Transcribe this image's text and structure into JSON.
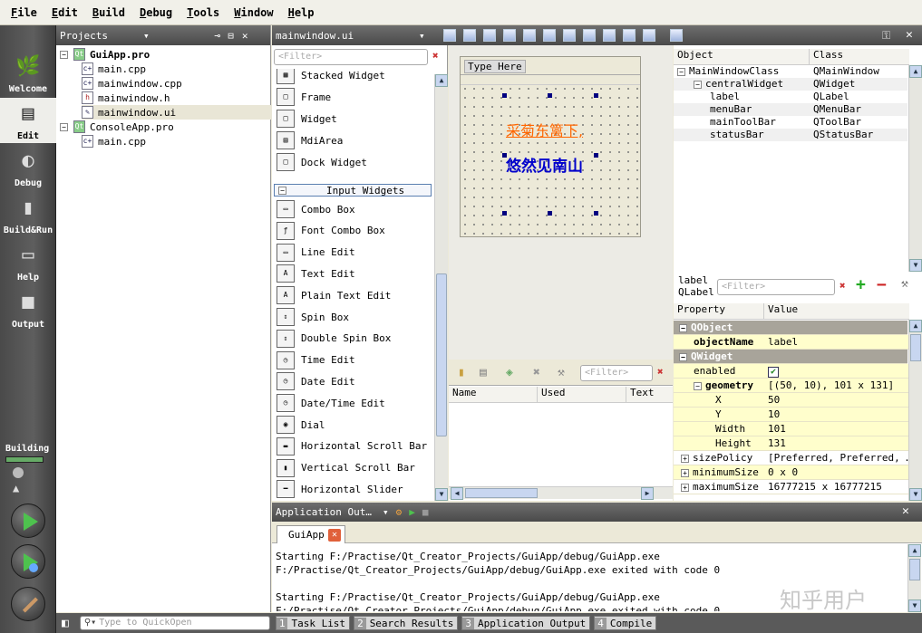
{
  "menubar": [
    "File",
    "Edit",
    "Build",
    "Debug",
    "Tools",
    "Window",
    "Help"
  ],
  "modes": [
    {
      "label": "Welcome",
      "icon": "welcome-icon"
    },
    {
      "label": "Edit",
      "icon": "edit-icon"
    },
    {
      "label": "Debug",
      "icon": "debug-icon"
    },
    {
      "label": "Build&Run",
      "icon": "build-run-icon"
    },
    {
      "label": "Help",
      "icon": "help-icon"
    },
    {
      "label": "Output",
      "icon": "output-icon"
    }
  ],
  "build": {
    "label": "Building"
  },
  "projects": {
    "title": "Projects",
    "tree": [
      {
        "label": "GuiApp.pro",
        "kind": "pro",
        "bold": true
      },
      {
        "label": "main.cpp",
        "kind": "cpp"
      },
      {
        "label": "mainwindow.cpp",
        "kind": "cpp"
      },
      {
        "label": "mainwindow.h",
        "kind": "h"
      },
      {
        "label": "mainwindow.ui",
        "kind": "ui",
        "selected": true
      },
      {
        "label": "ConsoleApp.pro",
        "kind": "pro"
      },
      {
        "label": "main.cpp",
        "kind": "cpp"
      }
    ]
  },
  "editor": {
    "file": "mainwindow.ui"
  },
  "widgetbox": {
    "filter_placeholder": "<Filter>",
    "items": [
      "Stacked Widget",
      "Frame",
      "Widget",
      "MdiArea",
      "Dock Widget"
    ],
    "group": "Input Widgets",
    "input_items": [
      "Combo Box",
      "Font Combo Box",
      "Line Edit",
      "Text Edit",
      "Plain Text Edit",
      "Spin Box",
      "Double Spin Box",
      "Time Edit",
      "Date Edit",
      "Date/Time Edit",
      "Dial",
      "Horizontal Scroll Bar",
      "Vertical Scroll Bar",
      "Horizontal Slider"
    ]
  },
  "form": {
    "menu_placeholder": "Type Here",
    "line1": "采菊东篱下,",
    "line2": "悠然见南山"
  },
  "signals": {
    "filter_placeholder": "<Filter>",
    "columns": [
      "Name",
      "Used",
      "Text"
    ]
  },
  "objinspector": {
    "columns": [
      "Object",
      "Class"
    ],
    "rows": [
      {
        "object": "MainWindowClass",
        "class": "QMainWindow"
      },
      {
        "object": "centralWidget",
        "class": "QWidget"
      },
      {
        "object": "label",
        "class": "QLabel"
      },
      {
        "object": "menuBar",
        "class": "QMenuBar"
      },
      {
        "object": "mainToolBar",
        "class": "QToolBar"
      },
      {
        "object": "statusBar",
        "class": "QStatusBar"
      }
    ]
  },
  "propeditor": {
    "object": "label",
    "class": "QLabel",
    "filter_placeholder": "<Filter>",
    "columns": [
      "Property",
      "Value"
    ],
    "rows": [
      {
        "p": "QObject",
        "v": "",
        "type": "group"
      },
      {
        "p": "objectName",
        "v": "label",
        "type": "bold"
      },
      {
        "p": "QWidget",
        "v": "",
        "type": "group"
      },
      {
        "p": "enabled",
        "v": "✔",
        "type": "check"
      },
      {
        "p": "geometry",
        "v": "[(50, 10), 101 x 131]",
        "type": "boldyel"
      },
      {
        "p": "X",
        "v": "50",
        "type": "sub"
      },
      {
        "p": "Y",
        "v": "10",
        "type": "sub"
      },
      {
        "p": "Width",
        "v": "101",
        "type": "sub"
      },
      {
        "p": "Height",
        "v": "131",
        "type": "sub"
      },
      {
        "p": "sizePolicy",
        "v": "[Preferred, Preferred, …",
        "type": "norm"
      },
      {
        "p": "minimumSize",
        "v": "0 x 0",
        "type": "normyel"
      },
      {
        "p": "maximumSize",
        "v": "16777215 x 16777215",
        "type": "norm"
      }
    ]
  },
  "output": {
    "title": "Application Out…",
    "tab": "GuiApp",
    "lines": [
      "Starting F:/Practise/Qt_Creator_Projects/GuiApp/debug/GuiApp.exe",
      "F:/Practise/Qt_Creator_Projects/GuiApp/debug/GuiApp.exe exited with code 0",
      "",
      "Starting F:/Practise/Qt_Creator_Projects/GuiApp/debug/GuiApp.exe",
      "F:/Practise/Qt_Creator_Projects/GuiApp/debug/GuiApp.exe exited with code 0"
    ]
  },
  "statusbar": {
    "quickopen_placeholder": "Type to QuickOpen",
    "tabs": [
      {
        "num": "1",
        "label": "Task List"
      },
      {
        "num": "2",
        "label": "Search Results"
      },
      {
        "num": "3",
        "label": "Application Output"
      },
      {
        "num": "4",
        "label": "Compile"
      }
    ]
  },
  "watermark": "知乎用户",
  "colors": {
    "accent": "#000080",
    "orange_text": "#ff6600",
    "blue_text": "#0000cc",
    "group_bg": "#a8a49a",
    "sel_yellow": "#fffecc"
  }
}
